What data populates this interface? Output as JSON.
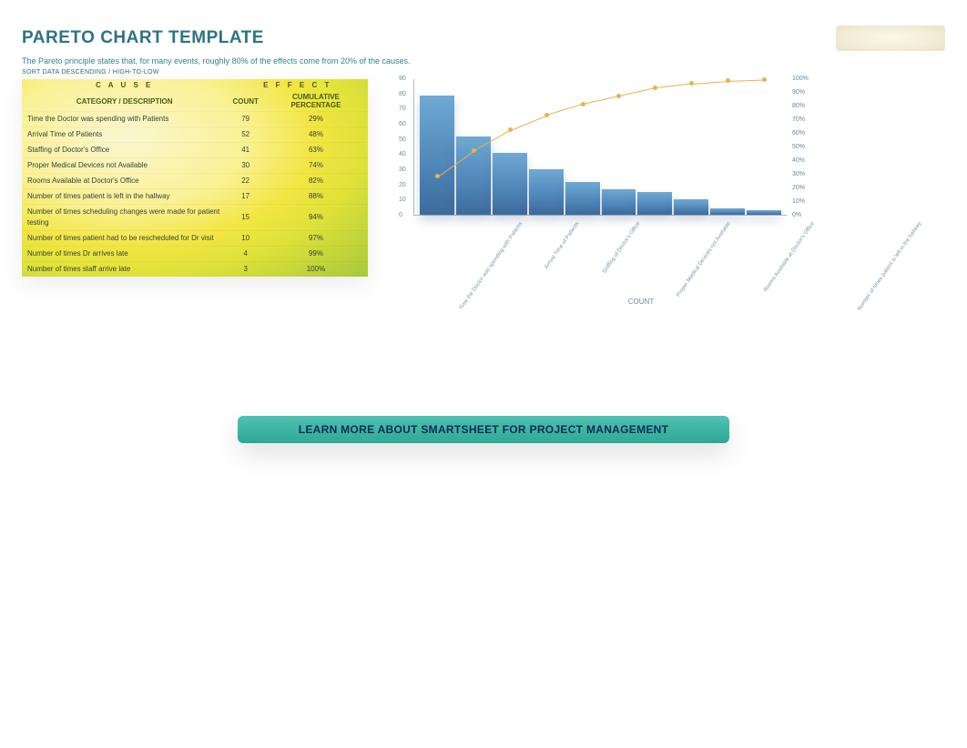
{
  "header": {
    "title": "PARETO CHART TEMPLATE",
    "logo_text": ""
  },
  "principle_text": "The Pareto principle states that, for many events, roughly 80% of the effects come from 20% of the causes.",
  "sort_note": "SORT DATA DESCENDING / HIGH-TO-LOW",
  "table": {
    "sup_cause": "C A U S E",
    "sup_effect": "E F F E C T",
    "col_cat": "CATEGORY / DESCRIPTION",
    "col_count": "COUNT",
    "col_pct": "CUMULATIVE PERCENTAGE",
    "rows": [
      {
        "cat": "Time the Doctor was spending with Patients",
        "count": "79",
        "pct": "29%"
      },
      {
        "cat": "Arrival Time of Patients",
        "count": "52",
        "pct": "48%"
      },
      {
        "cat": " Staffing of Doctor's Office",
        "count": "41",
        "pct": "63%"
      },
      {
        "cat": "Proper Medical Devices not Available",
        "count": "30",
        "pct": "74%"
      },
      {
        "cat": "Rooms Available at Doctor's Office",
        "count": "22",
        "pct": "82%"
      },
      {
        "cat": " Number of times patient is left in the hallway",
        "count": "17",
        "pct": "88%"
      },
      {
        "cat": "Number of times scheduling changes were made for patient testing",
        "count": "15",
        "pct": "94%"
      },
      {
        "cat": "Number of times patient had to be rescheduled for Dr visit",
        "count": "10",
        "pct": "97%"
      },
      {
        "cat": " Number of times Dr arrives late",
        "count": "4",
        "pct": "99%"
      },
      {
        "cat": "Number of times staff arrive late",
        "count": "3",
        "pct": "100%"
      }
    ]
  },
  "cta_label": "LEARN MORE ABOUT SMARTSHEET FOR PROJECT MANAGEMENT",
  "chart_data": {
    "type": "pareto",
    "title": "COUNT",
    "categories": [
      "Time the Doctor was spending with Patients",
      "Arrival Time of Patients",
      "Staffing of Doctor's Office",
      "Proper Medical Devices not Available",
      "Rooms Available at Doctor's Office",
      "Number of times patient is left in the hallway",
      "Number of times scheduling changes were made for patient testing",
      "Number of times patient had to be rescheduled for Dr visit",
      "Number of times Dr arrives late",
      "Number of times staff arrive late"
    ],
    "series": [
      {
        "name": "COUNT",
        "type": "bar",
        "values": [
          79,
          52,
          41,
          30,
          22,
          17,
          15,
          10,
          4,
          3
        ]
      },
      {
        "name": "CUMULATIVE %",
        "type": "line",
        "values": [
          29,
          48,
          63,
          74,
          82,
          88,
          94,
          97,
          99,
          100
        ]
      }
    ],
    "y_left": {
      "label": "",
      "ticks": [
        0,
        10,
        20,
        30,
        40,
        50,
        60,
        70,
        80,
        90
      ],
      "lim": [
        0,
        90
      ]
    },
    "y_right": {
      "label": "",
      "ticks": [
        "0%",
        "10%",
        "20%",
        "30%",
        "40%",
        "50%",
        "60%",
        "70%",
        "80%",
        "90%",
        "100%"
      ],
      "lim": [
        0,
        100
      ]
    }
  }
}
